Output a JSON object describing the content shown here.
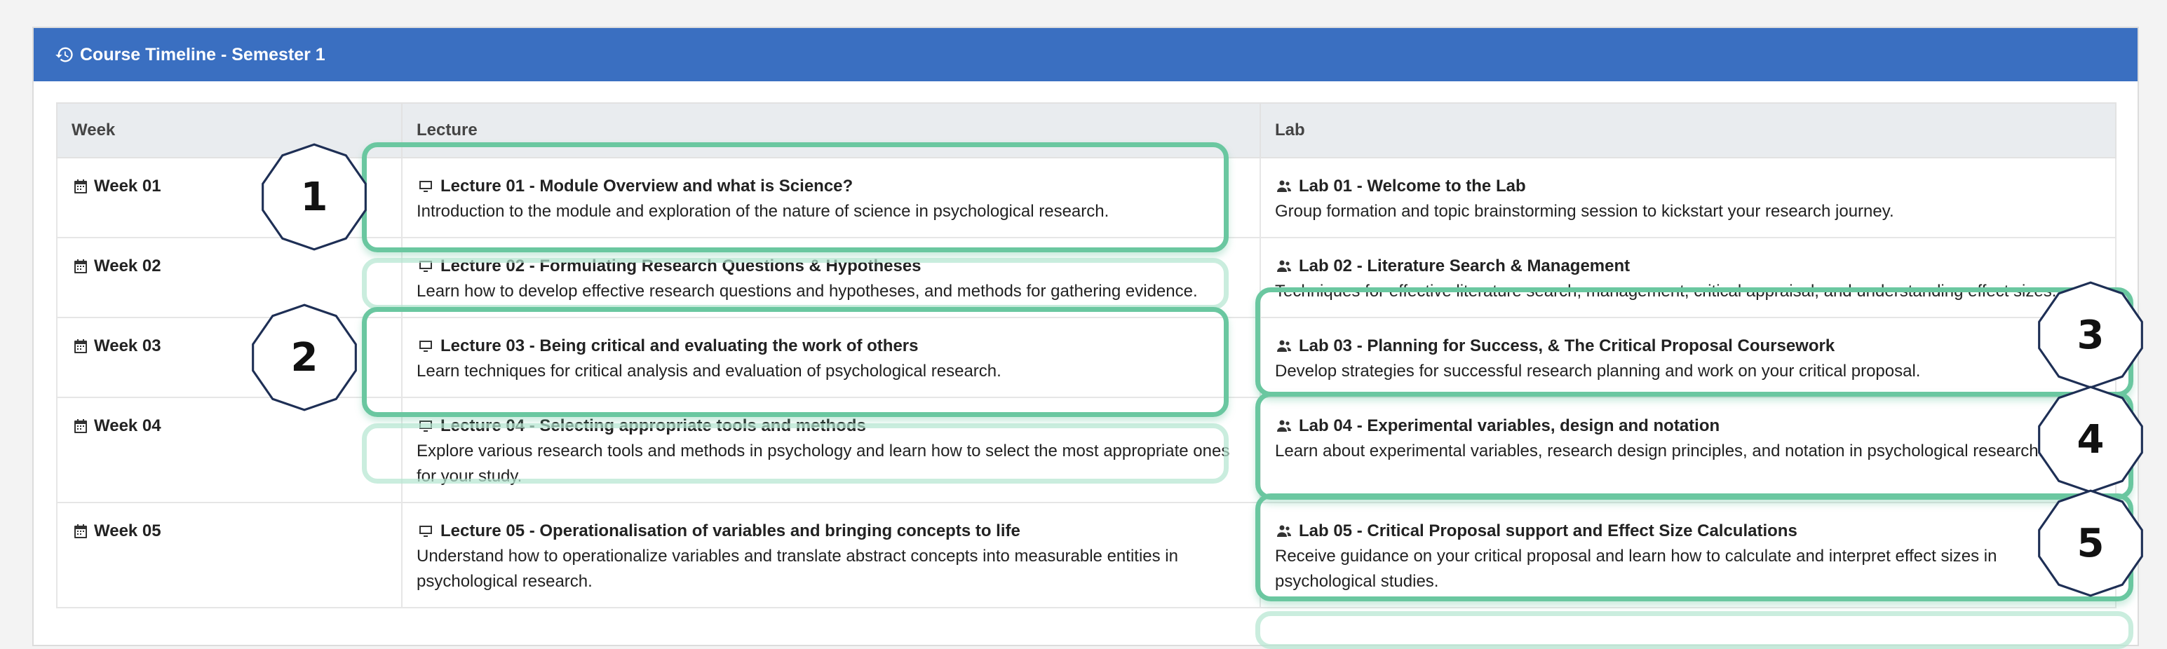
{
  "header": {
    "title": "Course Timeline - Semester 1",
    "icon": "history-icon"
  },
  "table": {
    "columns": [
      "Week",
      "Lecture",
      "Lab"
    ],
    "rows": [
      {
        "week": "Week 01",
        "lecture_title": "Lecture 01 - Module Overview and what is Science?",
        "lecture_desc": "Introduction to the module and exploration of the nature of science in psychological research.",
        "lab_title": "Lab 01 - Welcome to the Lab",
        "lab_desc": "Group formation and topic brainstorming session to kickstart your research journey."
      },
      {
        "week": "Week 02",
        "lecture_title": "Lecture 02 - Formulating Research Questions & Hypotheses",
        "lecture_desc": "Learn how to develop effective research questions and hypotheses, and methods for gathering evidence.",
        "lab_title": "Lab 02 - Literature Search & Management",
        "lab_desc": "Techniques for effective literature search, management, critical appraisal, and understanding effect sizes."
      },
      {
        "week": "Week 03",
        "lecture_title": "Lecture 03 - Being critical and evaluating the work of others",
        "lecture_desc": "Learn techniques for critical analysis and evaluation of psychological research.",
        "lab_title": "Lab 03 - Planning for Success, & The Critical Proposal Coursework",
        "lab_desc": "Develop strategies for successful research planning and work on your critical proposal."
      },
      {
        "week": "Week 04",
        "lecture_title": "Lecture 04 - Selecting appropriate tools and methods",
        "lecture_desc": "Explore various research tools and methods in psychology and learn how to select the most appropriate ones for your study.",
        "lab_title": "Lab 04 - Experimental variables, design and notation",
        "lab_desc": "Learn about experimental variables, research design principles, and notation in psychological research."
      },
      {
        "week": "Week 05",
        "lecture_title": "Lecture 05 - Operationalisation of variables and bringing concepts to life",
        "lecture_desc": "Understand how to operationalize variables and translate abstract concepts into measurable entities in psychological research.",
        "lab_title": "Lab 05 - Critical Proposal support and Effect Size Calculations",
        "lab_desc": "Receive guidance on your critical proposal and learn how to calculate and interpret effect sizes in psychological studies."
      }
    ]
  },
  "annotations": {
    "labels": [
      "1",
      "2",
      "3",
      "4",
      "5"
    ],
    "highlight_color": "#6ac7a0"
  },
  "colors": {
    "header_bg": "#3a6fc1",
    "table_head_bg": "#e9ecef"
  }
}
